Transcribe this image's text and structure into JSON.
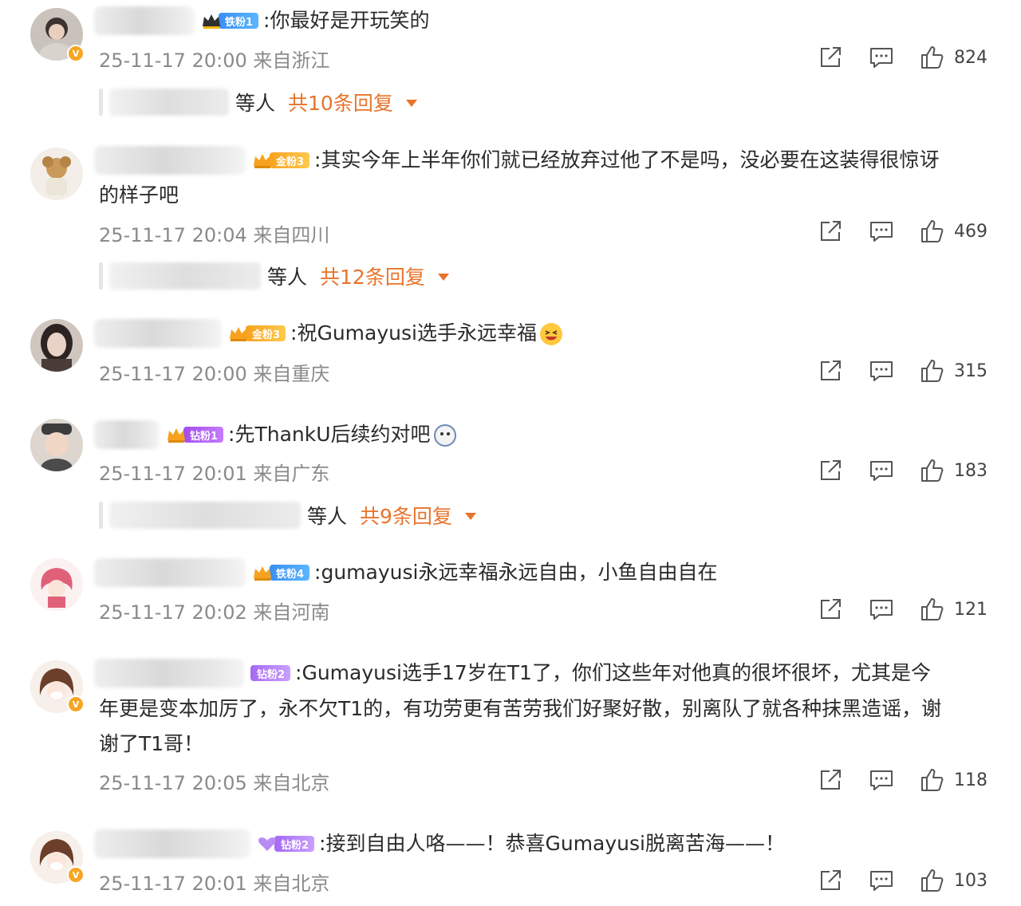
{
  "colors": {
    "accent_orange": "#e8742b",
    "meta_gray": "#8a8a8a",
    "badge_iron": "#3a8ef2",
    "badge_gold": "#f6a21f",
    "badge_diamond": "#a24df0"
  },
  "comments": [
    {
      "badge": "铁粉1",
      "badge_type": "iron",
      "text": ":你最好是开玩笑的",
      "meta": "25-11-17 20:00 来自浙江",
      "likes": "824",
      "replies": {
        "suffix": "等人",
        "count_text": "共10条回复"
      },
      "verified": true
    },
    {
      "badge": "金粉3",
      "badge_type": "gold",
      "text": ":其实今年上半年你们就已经放弃过他了不是吗，没必要在这装得很惊讶",
      "text2": "的样子吧",
      "meta": "25-11-17 20:04 来自四川",
      "likes": "469",
      "replies": {
        "suffix": "等人",
        "count_text": "共12条回复"
      },
      "verified": false
    },
    {
      "badge": "金粉3",
      "badge_type": "gold",
      "text": ":祝Gumayusi选手永远幸福",
      "meta": "25-11-17 20:00 来自重庆",
      "likes": "315",
      "verified": false
    },
    {
      "badge": "钻粉1",
      "badge_type": "diamond",
      "text": ":先ThankU后续约对吧",
      "meta": "25-11-17 20:01 来自广东",
      "likes": "183",
      "replies": {
        "suffix": "等人",
        "count_text": "共9条回复"
      },
      "verified": false
    },
    {
      "badge": "铁粉4",
      "badge_type": "iron",
      "text": ":gumayusi永远幸福永远自由，小鱼自由自在",
      "meta": "25-11-17 20:02 来自河南",
      "likes": "121",
      "verified": false
    },
    {
      "badge": "钻粉2",
      "badge_type": "diamond-lite",
      "text": ":Gumayusi选手17岁在T1了，你们这些年对他真的很坏很坏，尤其是今",
      "text2": "年更是变本加厉了，永不欠T1的，有功劳更有苦劳我们好聚好散，别离队了就各种抹黑造谣，谢",
      "text3": "谢了T1哥！",
      "meta": "25-11-17 20:05 来自北京",
      "likes": "118",
      "verified": true
    },
    {
      "badge": "钻粉2",
      "badge_type": "diamond-lite",
      "text": ":接到自由人咯——！恭喜Gumayusi脱离苦海——！",
      "meta": "25-11-17 20:01 来自北京",
      "likes": "103",
      "verified": true
    }
  ]
}
